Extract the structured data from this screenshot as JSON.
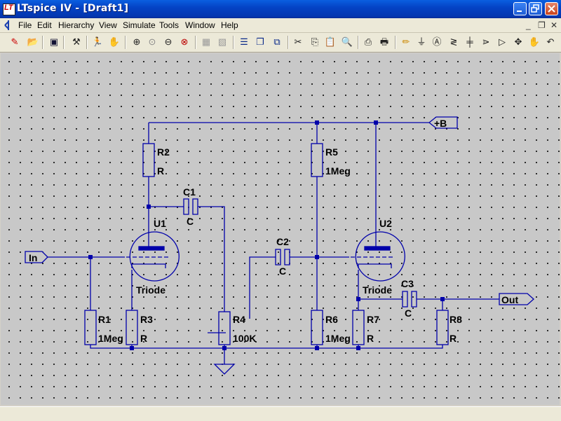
{
  "window": {
    "title": "LTspice IV - [Draft1]",
    "app_icon_letter": "LT"
  },
  "menu": [
    "File",
    "Edit",
    "Hierarchy",
    "View",
    "Simulate",
    "Tools",
    "Window",
    "Help"
  ],
  "toolbar_icons": [
    "new-schematic-icon",
    "open-icon",
    "save-icon",
    "control-panel-icon",
    "run-icon",
    "halt-icon",
    "zoom-in-icon",
    "pan-icon",
    "zoom-out-icon",
    "zoom-cancel-icon",
    "autorange-icon",
    "fit-icon",
    "tile-horizontal-icon",
    "cascade-icon",
    "close-all-icon",
    "cut-icon",
    "copy-icon",
    "paste-icon",
    "find-icon",
    "print-setup-icon",
    "print-icon",
    "draw-wire-icon",
    "ground-icon",
    "label-net-icon",
    "resistor-icon",
    "capacitor-icon",
    "diode-icon",
    "component-icon",
    "move-icon"
  ],
  "schematic": {
    "nets": {
      "plus_b": "+B",
      "in": "In",
      "out": "Out"
    },
    "parts": [
      {
        "ref": "R1",
        "value": "1Meg"
      },
      {
        "ref": "R2",
        "value": "R"
      },
      {
        "ref": "R3",
        "value": "R"
      },
      {
        "ref": "R4",
        "value": "100K"
      },
      {
        "ref": "R5",
        "value": "1Meg"
      },
      {
        "ref": "R6",
        "value": "1Meg"
      },
      {
        "ref": "R7",
        "value": "R"
      },
      {
        "ref": "R8",
        "value": "R"
      },
      {
        "ref": "C1",
        "value": "C"
      },
      {
        "ref": "C2",
        "value": "C"
      },
      {
        "ref": "C3",
        "value": "C"
      },
      {
        "ref": "U1",
        "value": "Triode"
      },
      {
        "ref": "U2",
        "value": "Triode"
      }
    ]
  },
  "colors": {
    "wire": "#0000aa",
    "canvas": "#c8c8c8",
    "titlebar": "#0a5fe0"
  }
}
